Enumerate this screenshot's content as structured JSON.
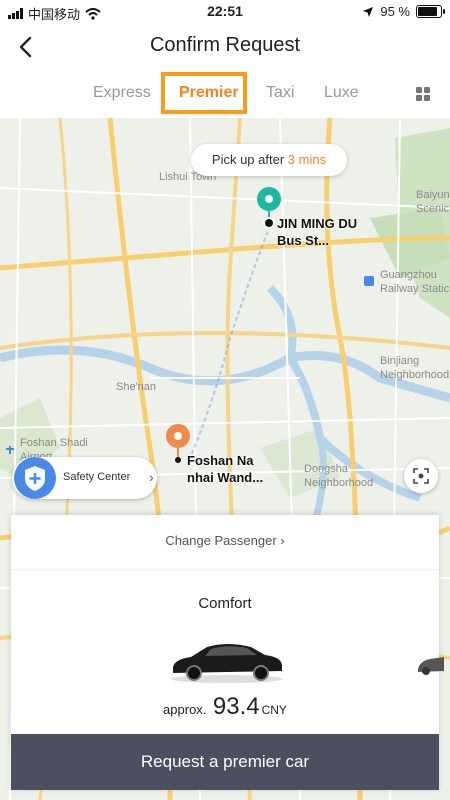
{
  "status_bar": {
    "carrier": "中国移动",
    "time": "22:51",
    "battery": "95 %"
  },
  "header": {
    "title": "Confirm Request"
  },
  "tabs": [
    {
      "label": "Express",
      "active": false
    },
    {
      "label": "Premier",
      "active": true
    },
    {
      "label": "Taxi",
      "active": false
    },
    {
      "label": "Luxe",
      "active": false
    }
  ],
  "map": {
    "pickup_prefix": "Pick up after",
    "pickup_time": "3 mins",
    "origin_label": "JIN MING DU Bus St...",
    "destination_label": "Foshan Na nhai Wand...",
    "places": [
      "Lishui Town",
      "Baiyun Scenic",
      "Guangzhou Railway Static",
      "Binjiang Neighborhood",
      "She'nan",
      "Foshan Shadi Airport",
      "Dongsha Neighborhood"
    ],
    "safety_center": "Safety Center"
  },
  "card": {
    "change_passenger": "Change Passenger",
    "car_type": "Comfort",
    "price_prefix": "approx.",
    "price_value": "93.4",
    "price_currency": "CNY"
  },
  "request_button": "Request a premier car",
  "colors": {
    "accent": "#f5821f",
    "button": "#4b4f5e",
    "pin_origin": "#1fb7a0",
    "pin_destination": "#f08a4b"
  }
}
